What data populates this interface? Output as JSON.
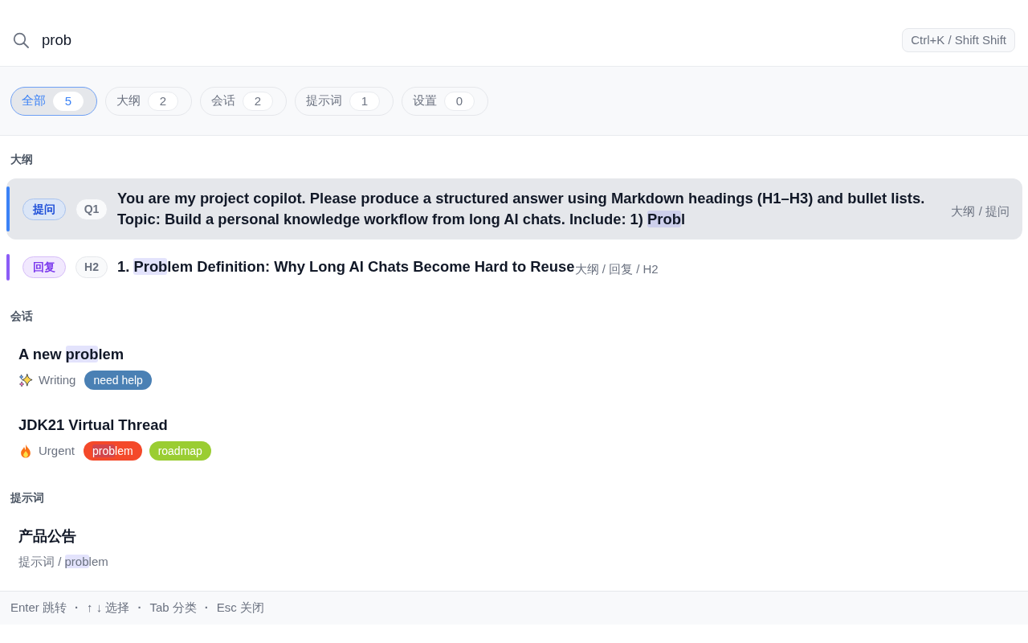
{
  "search": {
    "query": "prob",
    "shortcut": "Ctrl+K / Shift Shift"
  },
  "filters": [
    {
      "label": "全部",
      "count": "5",
      "selected": true
    },
    {
      "label": "大纲",
      "count": "2",
      "selected": false
    },
    {
      "label": "会话",
      "count": "2",
      "selected": false
    },
    {
      "label": "提示词",
      "count": "1",
      "selected": false
    },
    {
      "label": "设置",
      "count": "0",
      "selected": false
    }
  ],
  "sections": [
    {
      "kind": "outline",
      "title": "大纲",
      "items": [
        {
          "kind": "question",
          "role_label": "提问",
          "level_label": "Q1",
          "title": [
            {
              "text": "You are my project copilot. Please produce a structured answer using Markdown headings (H1–H3) and bullet lists. Topic: Build a personal knowledge workflow from long AI chats. Include: 1) ",
              "highlighted": false
            },
            {
              "text": "Prob",
              "highlighted": true
            },
            {
              "text": "l",
              "highlighted": false
            }
          ],
          "path": "大纲 / 提问",
          "selected": true
        },
        {
          "kind": "answer",
          "role_label": "回复",
          "level_label": "H2",
          "title": [
            {
              "text": "1. ",
              "highlighted": false
            },
            {
              "text": "Prob",
              "highlighted": true
            },
            {
              "text": "lem Definition: Why Long AI Chats Become Hard to Reuse",
              "highlighted": false
            }
          ],
          "path": "大纲 / 回复 / H2",
          "selected": false
        }
      ]
    },
    {
      "kind": "conversation",
      "title": "会话",
      "items": [
        {
          "title": [
            {
              "text": "A new ",
              "highlighted": false
            },
            {
              "text": "prob",
              "highlighted": true
            },
            {
              "text": "lem",
              "highlighted": false
            }
          ],
          "category": {
            "kind": "sparkles",
            "label": "Writing"
          },
          "tags": [
            {
              "text": "need help",
              "color": "#4a80b4"
            }
          ],
          "selected": false
        },
        {
          "title": [
            {
              "text": "JDK21 Virtual Thread",
              "highlighted": false
            }
          ],
          "category": {
            "kind": "fire",
            "label": "Urgent"
          },
          "tags": [
            {
              "segments": [
                {
                  "text": "prob",
                  "highlighted": true
                },
                {
                  "text": "lem",
                  "highlighted": false
                }
              ],
              "color": "#f4492a"
            },
            {
              "text": "roadmap",
              "color": "#9acd32"
            }
          ],
          "selected": false
        }
      ]
    },
    {
      "kind": "prompt",
      "title": "提示词",
      "items": [
        {
          "title": [
            {
              "text": "产品公告",
              "highlighted": false
            }
          ],
          "path": [
            {
              "text": "提示词 / ",
              "highlighted": false
            },
            {
              "text": "prob",
              "highlighted": true
            },
            {
              "text": "lem",
              "highlighted": false
            }
          ],
          "selected": false
        }
      ]
    }
  ],
  "footer": {
    "hints": [
      "Enter 跳转",
      "↑ ↓ 选择",
      "Tab 分类",
      "Esc 关闭"
    ],
    "separator": "·"
  }
}
